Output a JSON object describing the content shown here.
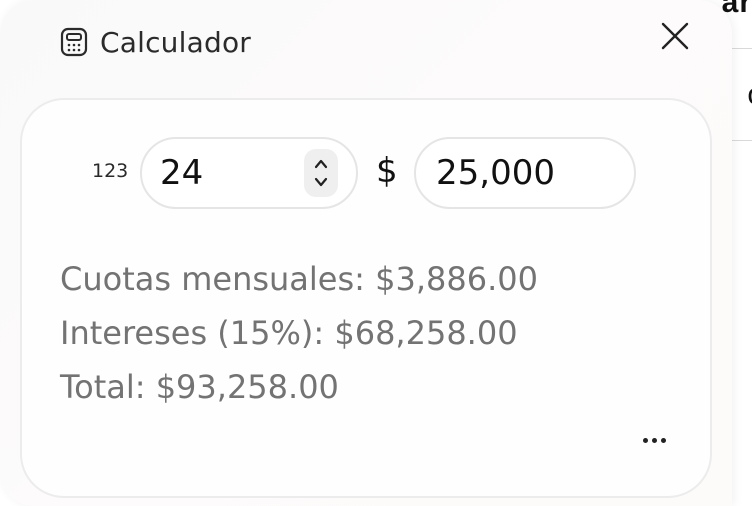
{
  "background": {
    "fragment_top": "ar",
    "fragment_mid": "o"
  },
  "header": {
    "icon": "calculator-icon",
    "title": "Calculador"
  },
  "close_icon": "close-icon",
  "inputs": {
    "count_prefix": "123",
    "count_value": "24",
    "stepper_icon": "chevron-up-down-icon",
    "currency_symbol": "$",
    "amount_value": "25,000"
  },
  "results": {
    "monthly": "Cuotas mensuales: $3,886.00",
    "interest": "Intereses (15%): $68,258.00",
    "total": "Total: $93,258.00"
  },
  "more_icon": "more-horizontal-icon"
}
